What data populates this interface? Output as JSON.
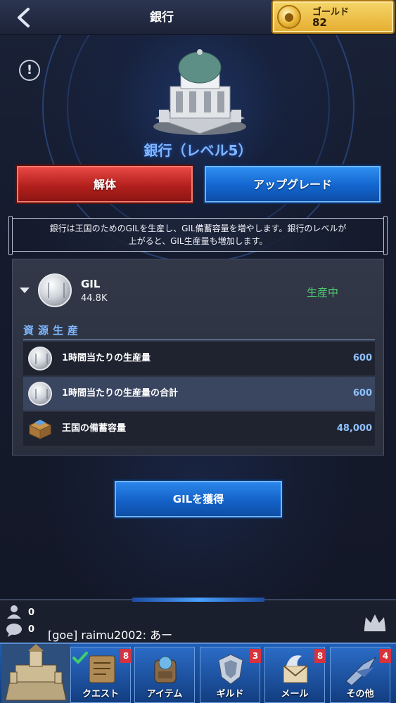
{
  "header": {
    "title": "銀行",
    "back_icon": "chevron-left-icon",
    "gold": {
      "label": "ゴールド",
      "value": "82"
    }
  },
  "building": {
    "title": "銀行（レベル5）",
    "dismantle_label": "解体",
    "upgrade_label": "アップグレード",
    "description_line1": "銀行は王国のためのGILを生産し、GIL備蓄容量を増やします。銀行のレベルが",
    "description_line2": "上がると、GIL生産量も増加します。"
  },
  "resource": {
    "name": "GIL",
    "amount": "44.8K",
    "status": "生産中",
    "section_title": "資源生産",
    "rows": [
      {
        "label": "1時間当たりの生産量",
        "value": "600"
      },
      {
        "label": "1時間当たりの生産量の合計",
        "value": "600"
      },
      {
        "label": "王国の備蓄容量",
        "value": "48,000"
      }
    ]
  },
  "get_gil_label": "GILを獲得",
  "chat": {
    "online_count": "0",
    "message_count": "0",
    "message": "[goe] raimu2002: あー"
  },
  "nav": {
    "items": [
      {
        "label": "クエスト",
        "badge": "8"
      },
      {
        "label": "アイテム",
        "badge": ""
      },
      {
        "label": "ギルド",
        "badge": "3"
      },
      {
        "label": "メール",
        "badge": "8"
      },
      {
        "label": "その他",
        "badge": "4"
      }
    ]
  },
  "colors": {
    "accent_blue": "#7fb6ff",
    "status_green": "#4fd171",
    "badge_red": "#d7323d",
    "gold": "#e5ad2f"
  }
}
